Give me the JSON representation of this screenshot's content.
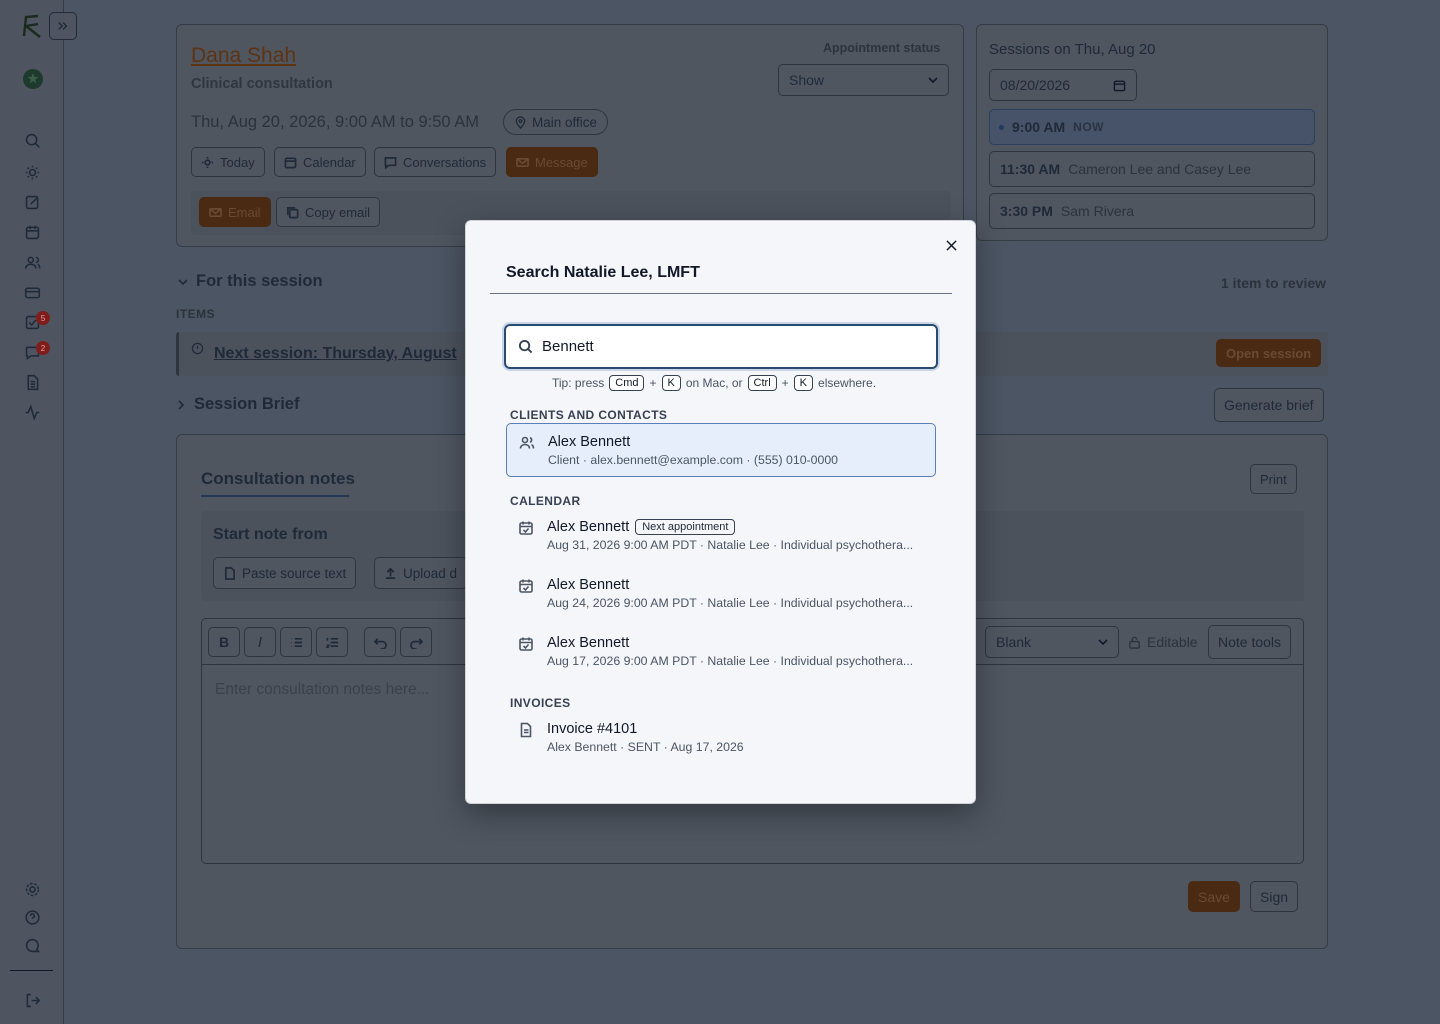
{
  "sidebar": {
    "badges": {
      "tasks": "5",
      "messages": "2"
    }
  },
  "client": {
    "name": "Dana Shah",
    "service": "Clinical consultation",
    "datetime": "Thu, Aug 20, 2026, 9:00 AM to 9:50 AM",
    "location": "Main office",
    "status_label": "Appointment status",
    "status_value": "Show",
    "actions": [
      "Today",
      "Calendar",
      "Conversations",
      "Message"
    ],
    "email_label": "Email",
    "copy_email_label": "Copy email"
  },
  "sessions": {
    "heading": "Sessions on Thu, Aug 20",
    "date_value": "08/20/2026",
    "items": [
      {
        "time": "9:00 AM",
        "who": "NOW"
      },
      {
        "time": "11:30 AM",
        "who": "Cameron Lee and Casey Lee"
      },
      {
        "time": "3:30 PM",
        "who": "Sam Rivera"
      }
    ]
  },
  "session_section": {
    "title": "For this session",
    "review": "1 item to review",
    "items_label": "ITEMS",
    "next_session": "Next session: Thursday, August",
    "open_session": "Open session",
    "brief_title": "Session Brief",
    "generate_brief": "Generate brief"
  },
  "notes": {
    "tab": "Consultation notes",
    "print": "Print",
    "start_from": "Start note from",
    "paste": "Paste source text",
    "upload": "Upload d",
    "template": "Blank",
    "editable": "Editable",
    "note_tools": "Note tools",
    "placeholder": "Enter consultation notes here...",
    "save": "Save",
    "sign": "Sign"
  },
  "modal": {
    "title": "Search Natalie Lee, LMFT",
    "query": "Bennett",
    "tip": {
      "press": "Tip: press",
      "cmd": "Cmd",
      "plus": "+",
      "k": "K",
      "on_mac": "on Mac, or",
      "ctrl": "Ctrl",
      "elsewhere": "elsewhere."
    },
    "sections": {
      "clients": "CLIENTS AND CONTACTS",
      "calendar": "CALENDAR",
      "invoices": "INVOICES"
    },
    "client_result": {
      "name": "Alex Bennett",
      "sub": "Client · alex.bennett@example.com · (555) 010-0000"
    },
    "calendar_results": [
      {
        "name": "Alex Bennett",
        "pill": "Next appointment",
        "sub": "Aug 31, 2026 9:00 AM PDT · Natalie Lee · Individual psychothera..."
      },
      {
        "name": "Alex Bennett",
        "sub": "Aug 24, 2026 9:00 AM PDT · Natalie Lee · Individual psychothera..."
      },
      {
        "name": "Alex Bennett",
        "sub": "Aug 17, 2026 9:00 AM PDT · Natalie Lee · Individual psychothera..."
      }
    ],
    "invoice_result": {
      "name": "Invoice #4101",
      "sub": "Alex Bennett · SENT · Aug 17, 2026"
    }
  }
}
